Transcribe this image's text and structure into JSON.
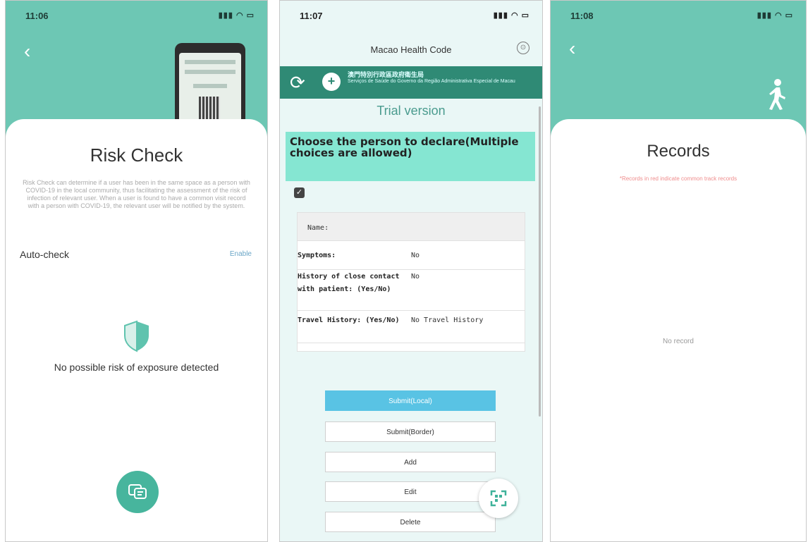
{
  "screen1": {
    "status_time": "11:06",
    "status_icons": "▮▮▮ ◠ ▭",
    "back_glyph": "‹",
    "title": "Risk Check",
    "description": "Risk Check can determine if a user has been in the same space as a person with COVID-19 in the local community, thus facilitating the assessment of the risk of infection of relevant user. When a user is found to have a common visit record with a person with COVID-19, the relevant user will be notified by the system.",
    "auto_check_label": "Auto-check",
    "auto_check_link": "Enable",
    "status_message": "No possible risk of exposure detected",
    "accent": "#6dc7b4"
  },
  "screen2": {
    "status_time": "11:07",
    "status_icons": "▮▮▮ ◠ ▭",
    "nav_title": "Macao Health Code",
    "nav_button": "⊙",
    "refresh_glyph": "⟳",
    "org_line1": "澳門特別行政區政府衛生局",
    "org_line2": "Serviços de Saúde do Governo da Região Administrativa Especial de Macau",
    "trial": "Trial version",
    "choose_heading": "Choose the person to declare(Multiple choices are allowed)",
    "check_glyph": "✓",
    "name_label": "Name:",
    "rows": [
      {
        "key": "Symptoms:",
        "value": "No"
      },
      {
        "key": "History of close contact with patient: (Yes/No)",
        "value": "No"
      },
      {
        "key": "Travel History: (Yes/No)",
        "value": "No Travel History"
      }
    ],
    "buttons": {
      "submit_local": "Submit(Local)",
      "submit_border": "Submit(Border)",
      "add": "Add",
      "edit": "Edit",
      "delete": "Delete"
    },
    "primary_color": "#59c3e4"
  },
  "screen3": {
    "status_time": "11:08",
    "status_icons": "▮▮▮ ◠ ▭",
    "back_glyph": "‹",
    "title": "Records",
    "note": "*Records in red indicate common track records",
    "empty": "No record"
  }
}
